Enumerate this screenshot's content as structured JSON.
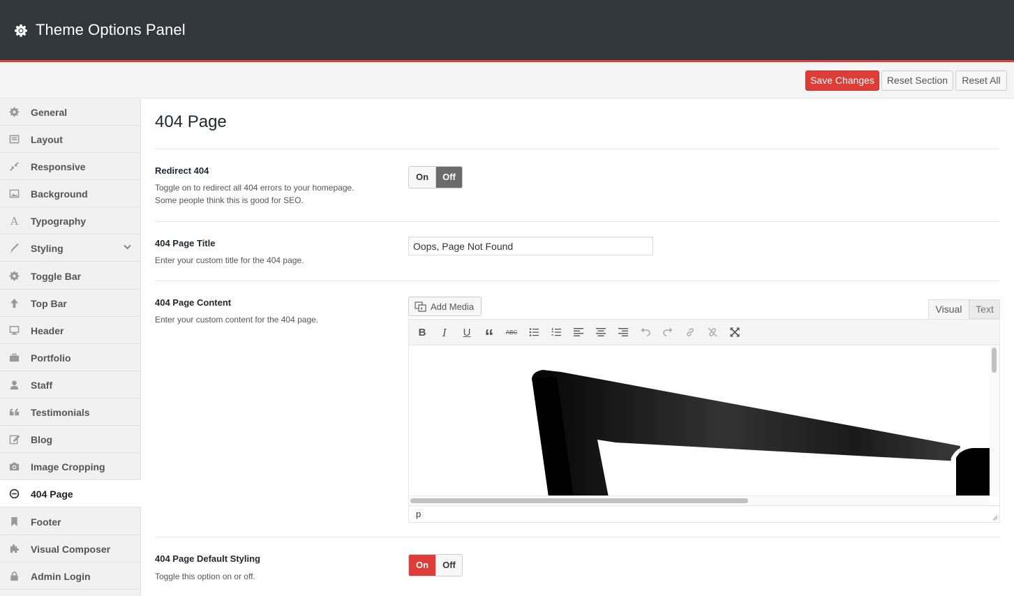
{
  "header": {
    "title": "Theme Options Panel",
    "icon": "gear-icon",
    "accent": "#dd3d36",
    "background": "#32373c"
  },
  "toolbar": {
    "save_label": "Save Changes",
    "reset_section_label": "Reset Section",
    "reset_all_label": "Reset All"
  },
  "sidebar": {
    "active": "404 Page",
    "items": [
      {
        "label": "General",
        "icon": "gear-icon"
      },
      {
        "label": "Layout",
        "icon": "layout-icon"
      },
      {
        "label": "Responsive",
        "icon": "compress-icon"
      },
      {
        "label": "Background",
        "icon": "image-icon"
      },
      {
        "label": "Typography",
        "icon": "font-icon"
      },
      {
        "label": "Styling",
        "icon": "brush-icon"
      },
      {
        "label": "Toggle Bar",
        "icon": "gear-icon"
      },
      {
        "label": "Top Bar",
        "icon": "arrow-up-icon"
      },
      {
        "label": "Header",
        "icon": "desktop-icon"
      },
      {
        "label": "Portfolio",
        "icon": "briefcase-icon"
      },
      {
        "label": "Staff",
        "icon": "user-icon"
      },
      {
        "label": "Testimonials",
        "icon": "quote-icon"
      },
      {
        "label": "Blog",
        "icon": "edit-icon"
      },
      {
        "label": "Image Cropping",
        "icon": "camera-icon"
      },
      {
        "label": "404 Page",
        "icon": "minus-circle-icon"
      },
      {
        "label": "Footer",
        "icon": "bookmark-icon"
      },
      {
        "label": "Visual Composer",
        "icon": "puzzle-icon"
      },
      {
        "label": "Admin Login",
        "icon": "lock-icon"
      }
    ]
  },
  "main": {
    "page_title": "404 Page",
    "redirect": {
      "title": "Redirect 404",
      "desc_line1": "Toggle on to redirect all 404 errors to your homepage.",
      "desc_line2": "Some people think this is good for SEO.",
      "on_label": "On",
      "off_label": "Off",
      "state": "off"
    },
    "page_title_option": {
      "title": "404 Page Title",
      "desc": "Enter your custom title for the 404 page.",
      "value": "Oops, Page Not Found"
    },
    "page_content": {
      "title": "404 Page Content",
      "desc": "Enter your custom content for the 404 page.",
      "add_media_label": "Add Media",
      "tab_visual": "Visual",
      "tab_text": "Text",
      "active_tab": "Visual",
      "toolbar_icons": [
        "bold-icon",
        "italic-icon",
        "underline-icon",
        "blockquote-icon",
        "strikethrough-icon",
        "bullet-list-icon",
        "numbered-list-icon",
        "align-left-icon",
        "align-center-icon",
        "align-right-icon",
        "undo-icon",
        "redo-icon",
        "link-icon",
        "unlink-icon",
        "fullscreen-icon"
      ],
      "bold_glyph": "B",
      "italic_glyph": "I",
      "underline_glyph": "U",
      "quote_glyph": "“",
      "strike_glyph": "ABC",
      "path_label": "p"
    },
    "default_styling": {
      "title": "404 Page Default Styling",
      "desc": "Toggle this option on or off.",
      "on_label": "On",
      "off_label": "Off",
      "state": "on"
    }
  }
}
